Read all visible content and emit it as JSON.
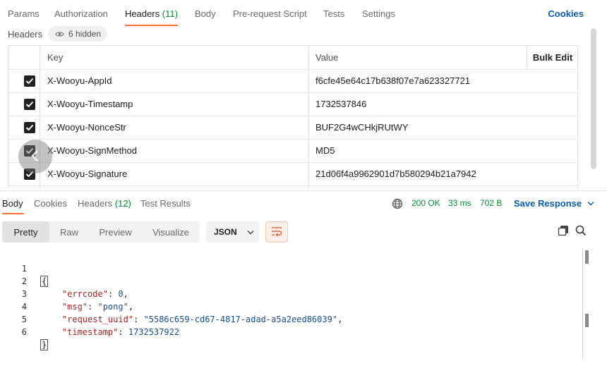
{
  "request_tabs": {
    "params": "Params",
    "authorization": "Authorization",
    "headers": "Headers",
    "headers_count": "(11)",
    "body": "Body",
    "prerequest": "Pre-request Script",
    "tests": "Tests",
    "settings": "Settings",
    "cookies": "Cookies"
  },
  "headers_section": {
    "label": "Headers",
    "hidden": "6 hidden"
  },
  "table": {
    "columns": {
      "key": "Key",
      "value": "Value",
      "bulk_edit": "Bulk Edit"
    },
    "rows": [
      {
        "checked": true,
        "key": "X-Wooyu-AppId",
        "value": "f6cfe45e64c17b638f07e7a623327721"
      },
      {
        "checked": true,
        "key": "X-Wooyu-Timestamp",
        "value": "1732537846"
      },
      {
        "checked": true,
        "key": "X-Wooyu-NonceStr",
        "value": "BUF2G4wCHkjRUtWY"
      },
      {
        "checked": true,
        "key": "X-Wooyu-SignMethod",
        "value": "MD5"
      },
      {
        "checked": true,
        "key": "X-Wooyu-Signature",
        "value": "21d06f4a9962901d7b580294b21a7942"
      }
    ]
  },
  "response_tabs": {
    "body": "Body",
    "cookies": "Cookies",
    "headers": "Headers",
    "headers_count": "(12)",
    "test_results": "Test Results"
  },
  "response_status": {
    "status": "200 OK",
    "time": "33 ms",
    "size": "702 B",
    "save": "Save Response"
  },
  "format_toolbar": {
    "pretty": "Pretty",
    "raw": "Raw",
    "preview": "Preview",
    "visualize": "Visualize",
    "language": "JSON"
  },
  "code": {
    "line_numbers": [
      "1",
      "2",
      "3",
      "4",
      "5",
      "6"
    ],
    "open_brace": "{",
    "close_brace": "}",
    "fields": [
      {
        "key": "\"errcode\"",
        "value": "0",
        "type": "number",
        "comma": true
      },
      {
        "key": "\"msg\"",
        "value": "\"pong\"",
        "type": "string",
        "comma": true
      },
      {
        "key": "\"request_uuid\"",
        "value": "\"5586c659-cd67-4817-adad-a5a2eed86039\"",
        "type": "string",
        "comma": true
      },
      {
        "key": "\"timestamp\"",
        "value": "1732537922",
        "type": "number",
        "comma": false
      }
    ]
  },
  "colors": {
    "accent": "#ff6c37",
    "link": "#0b5cad",
    "success": "#0a8a3b"
  }
}
